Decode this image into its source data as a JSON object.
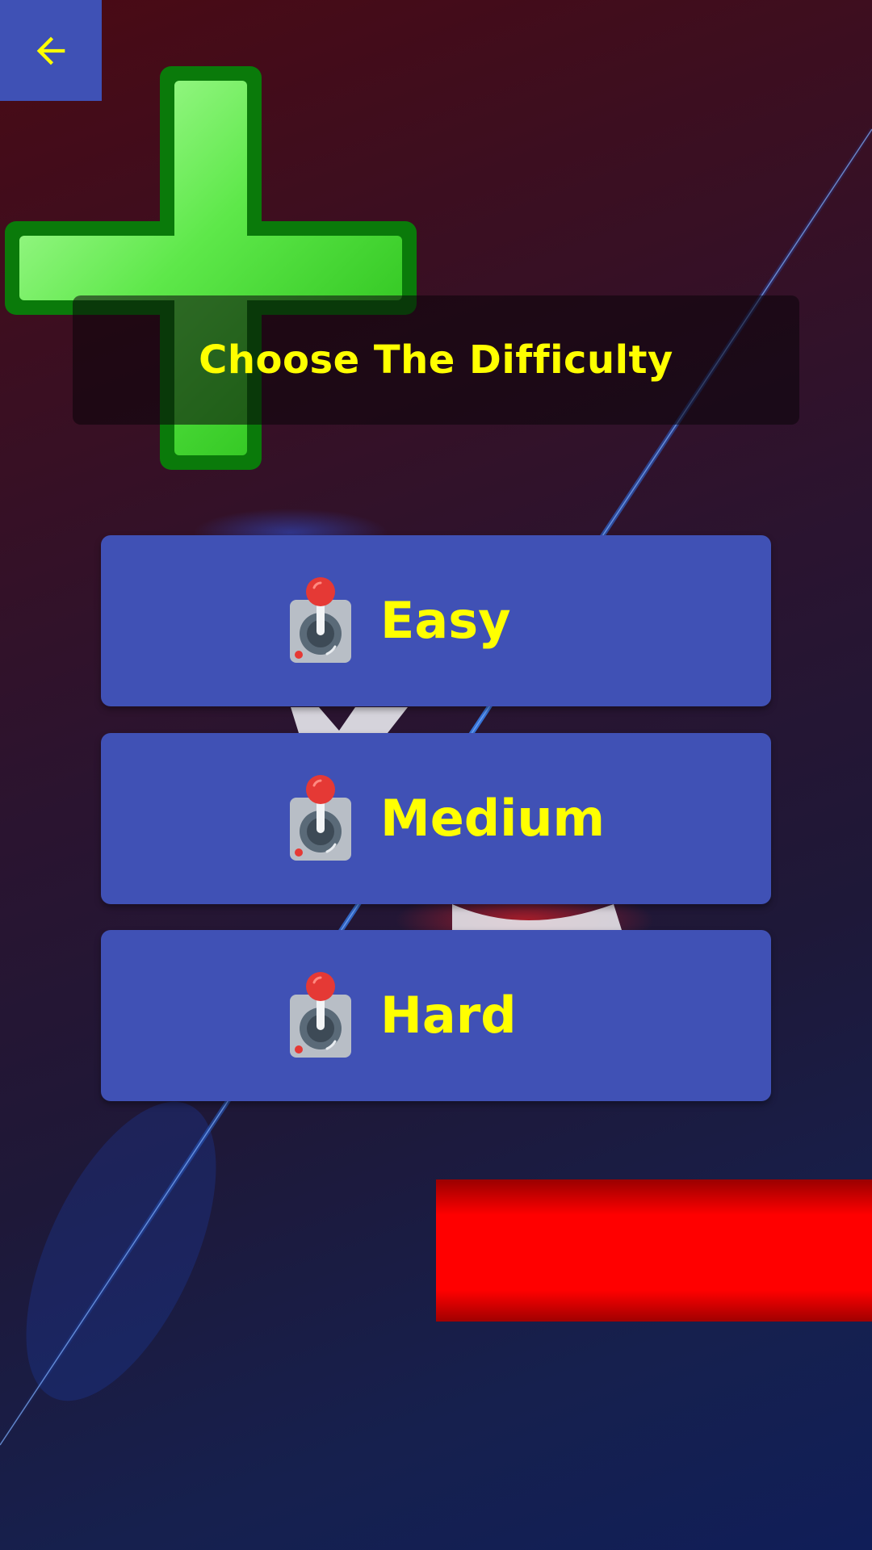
{
  "header": {
    "back_icon": "arrow-left-icon",
    "title": "Choose The Difficulty"
  },
  "difficulty": {
    "items": [
      {
        "label": "Easy",
        "icon": "joystick-icon"
      },
      {
        "label": "Medium",
        "icon": "joystick-icon"
      },
      {
        "label": "Hard",
        "icon": "joystick-icon"
      }
    ]
  },
  "decor": {
    "plus_icon": "green-plus-icon",
    "red_bar_color": "#ff0000",
    "accent_color": "#3f51b5",
    "text_color": "#ffff00"
  }
}
